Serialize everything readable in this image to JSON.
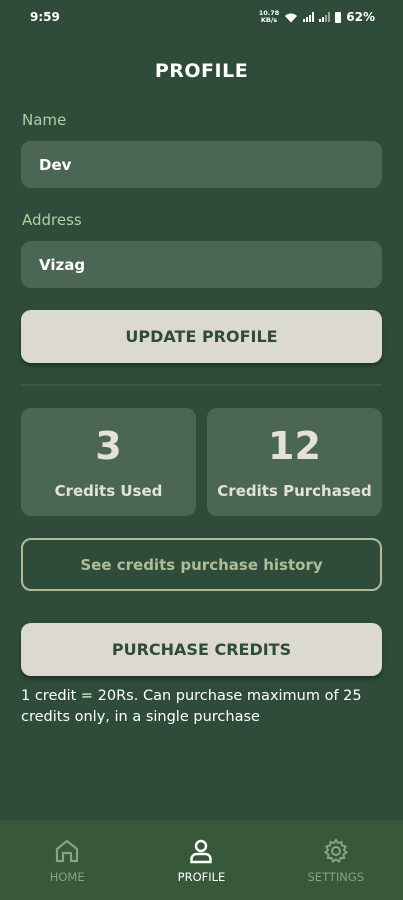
{
  "status_bar": {
    "time": "9:59",
    "net_speed_value": "10.78",
    "net_speed_unit": "KB/s",
    "battery": "62%"
  },
  "page": {
    "title": "PROFILE"
  },
  "form": {
    "name_label": "Name",
    "name_value": "Dev",
    "address_label": "Address",
    "address_value": "Vizag",
    "update_button": "UPDATE PROFILE"
  },
  "credits": {
    "used_value": "3",
    "used_label": "Credits Used",
    "purchased_value": "12",
    "purchased_label": "Credits Purchased",
    "history_button": "See credits purchase history",
    "purchase_button": "PURCHASE CREDITS",
    "note": "1 credit = 20Rs. Can purchase maximum of 25 credits only, in a single purchase"
  },
  "nav": {
    "items": [
      {
        "label": "HOME",
        "icon": "home-icon"
      },
      {
        "label": "PROFILE",
        "icon": "person-icon"
      },
      {
        "label": "SETTINGS",
        "icon": "gear-icon"
      }
    ],
    "active": "PROFILE"
  },
  "colors": {
    "background": "#2f4c3b",
    "field": "#4c6656",
    "button_light": "#dcdad0",
    "accent_outline": "#aebd97",
    "label": "#b6cca3",
    "bottom_nav": "#375839"
  }
}
